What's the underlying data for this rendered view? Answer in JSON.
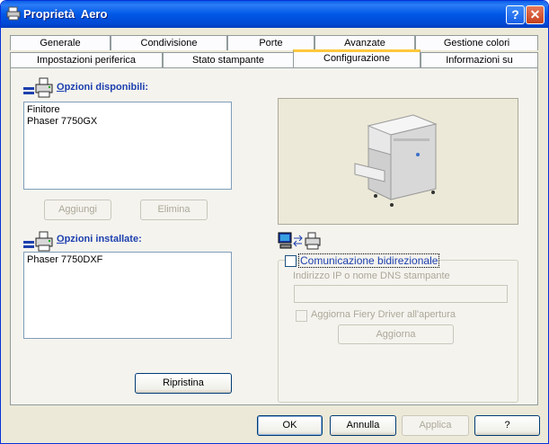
{
  "window": {
    "title": "Proprietà  Aero",
    "help_label": "?",
    "close_label": "✕"
  },
  "tabs_row1": [
    {
      "label": "Generale"
    },
    {
      "label": "Condivisione"
    },
    {
      "label": "Porte"
    },
    {
      "label": "Avanzate"
    },
    {
      "label": "Gestione colori"
    }
  ],
  "tabs_row2": [
    {
      "label": "Impostazioni periferica"
    },
    {
      "label": "Stato stampante"
    },
    {
      "label": "Configurazione",
      "active": true
    },
    {
      "label": "Informazioni su"
    }
  ],
  "available": {
    "label_u": "O",
    "label_rest": "pzioni disponibili:",
    "items": [
      "Finitore",
      "Phaser 7750GX"
    ],
    "add_label": "Aggiungi",
    "remove_label": "Elimina"
  },
  "installed": {
    "label_u": "O",
    "label_rest": "pzioni installate:",
    "items": [
      "Phaser 7750DXF"
    ],
    "restore_label": "Ripristina"
  },
  "bidir": {
    "checkbox_label": "Comunicazione bidirezionale",
    "ip_label": "Indirizzo IP o nome DNS stampante",
    "ip_value": "",
    "fiery_label": "Aggiorna Fiery Driver all'apertura",
    "update_label": "Aggiorna"
  },
  "footer": {
    "ok": "OK",
    "cancel": "Annulla",
    "apply": "Applica",
    "help": "?"
  }
}
